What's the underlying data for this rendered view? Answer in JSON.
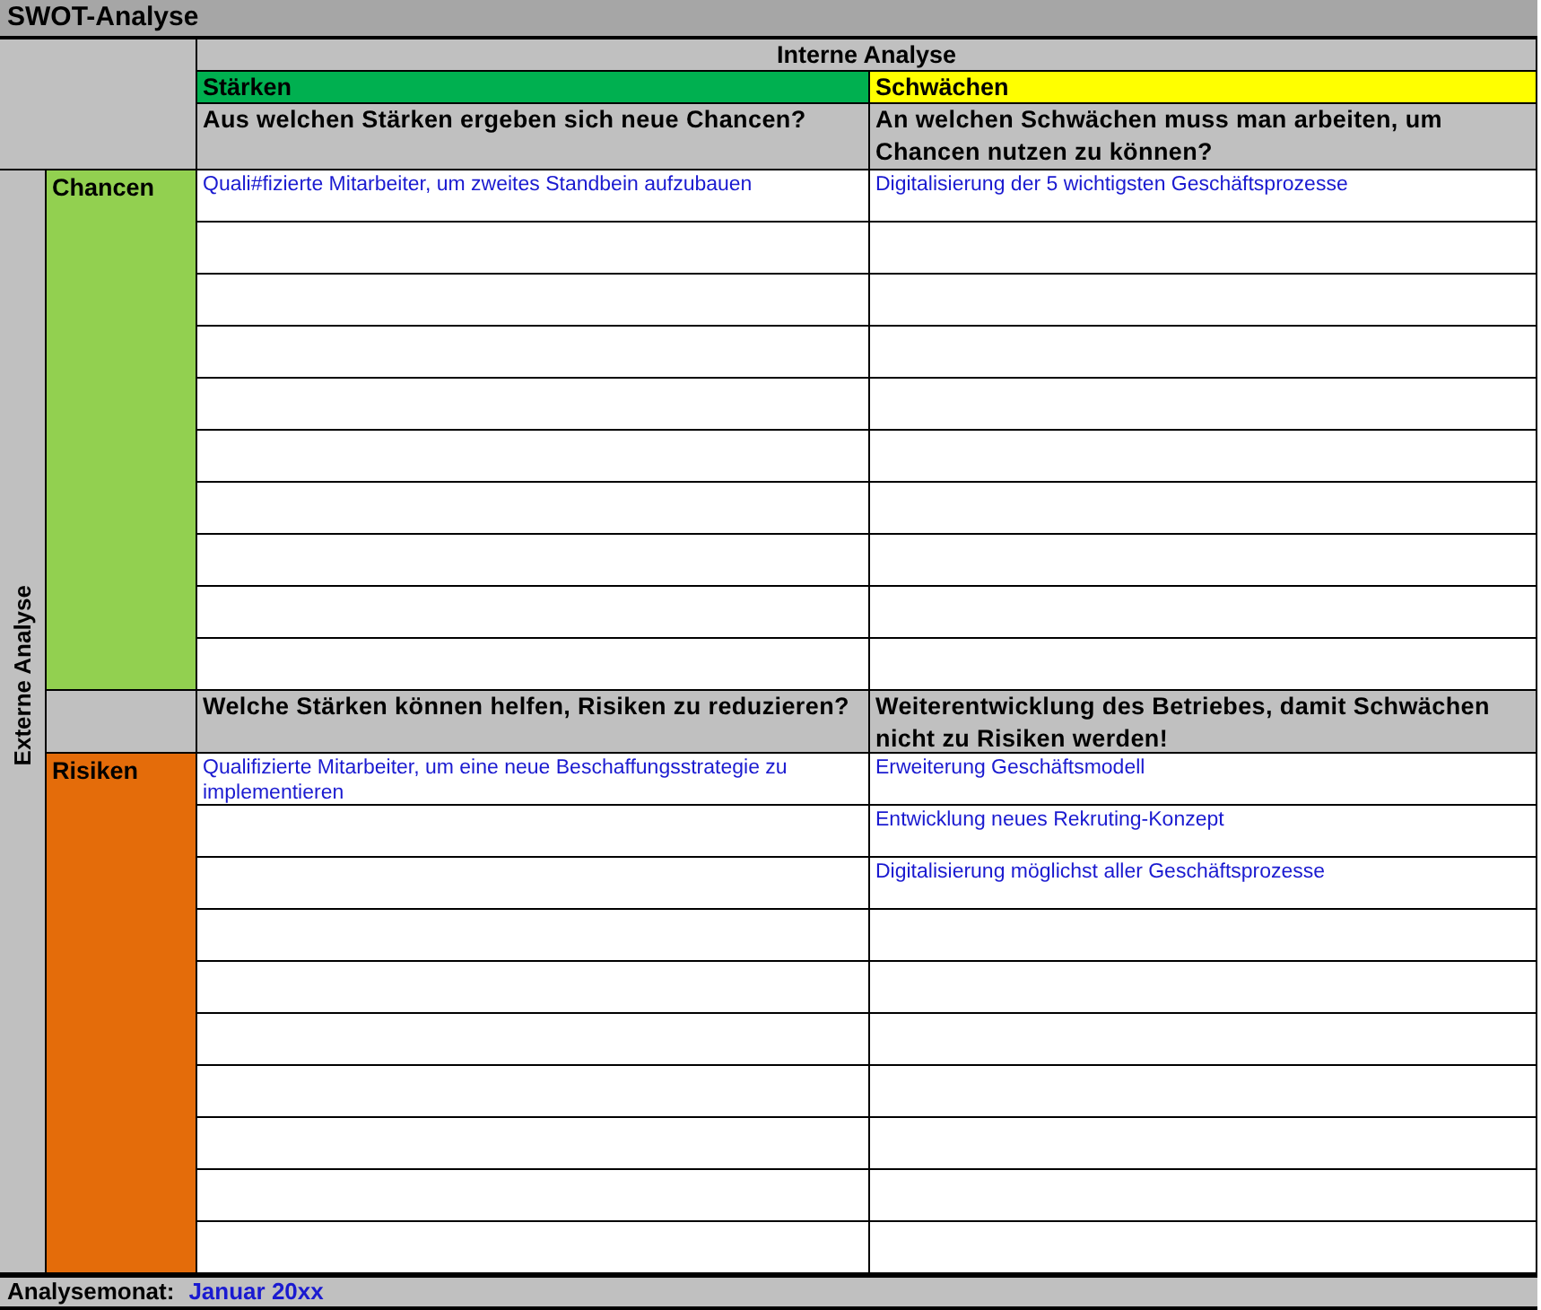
{
  "title": "SWOT-Analyse",
  "internal_header": "Interne Analyse",
  "external_header": "Externe Analyse",
  "columns": [
    {
      "label": "Stärken",
      "color": "#00b050"
    },
    {
      "label": "Schwächen",
      "color": "#ffff00"
    }
  ],
  "sections": [
    {
      "label": "Chancen",
      "color": "#92d050",
      "questions": [
        "Aus welchen Stärken ergeben sich neue Chancen?",
        "An welchen Schwächen muss man arbeiten, um Chancen nutzen zu können?"
      ],
      "entries": [
        [
          "Quali#fizierte Mitarbeiter, um zweites Standbein aufzubauen"
        ],
        [
          "Digitalisierung der 5 wichtigsten Geschäftsprozesse"
        ]
      ]
    },
    {
      "label": "Risiken",
      "color": "#e46c0a",
      "questions": [
        "Welche Stärken können helfen, Risiken zu reduzieren?",
        "Weiterentwicklung des Betriebes, damit Schwächen nicht zu Risiken werden!"
      ],
      "entries": [
        [
          "Qualifizierte Mitarbeiter, um eine neue Beschaffungsstrategie zu implementieren"
        ],
        [
          "Erweiterung Geschäftsmodell",
          "Entwicklung neues Rekruting-Konzept",
          "Digitalisierung möglichst aller Geschäftsprozesse"
        ]
      ]
    }
  ],
  "footer": {
    "label": "Analysemonat:",
    "value": "Januar 20xx"
  }
}
